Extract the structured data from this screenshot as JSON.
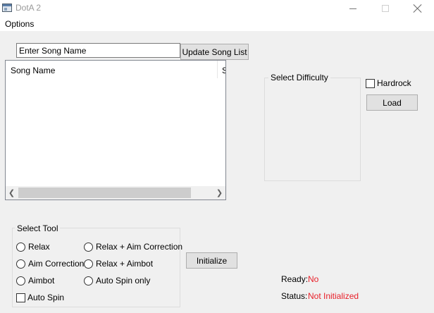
{
  "window": {
    "title": "DotA 2",
    "icon": "application-window-icon",
    "controls": {
      "minimize": "minimize-icon",
      "maximize": "maximize-icon",
      "close": "close-icon"
    }
  },
  "menu": {
    "items": [
      {
        "label": "Options"
      }
    ]
  },
  "song_search": {
    "value": "Enter Song Name"
  },
  "buttons": {
    "update_song_list": "Update Song List",
    "load": "Load",
    "initialize": "Initialize"
  },
  "song_list": {
    "columns": [
      "Song Name",
      "S"
    ],
    "rows": []
  },
  "difficulty": {
    "group_label": "Select Difficulty",
    "hardrock_label": "Hardrock",
    "hardrock_checked": false
  },
  "tool": {
    "group_label": "Select Tool",
    "options": [
      {
        "label": "Relax",
        "selected": false
      },
      {
        "label": "Aim Correction",
        "selected": false
      },
      {
        "label": "Aimbot",
        "selected": false
      },
      {
        "label": "Relax + Aim Correction",
        "selected": false
      },
      {
        "label": "Relax + Aimbot",
        "selected": false
      },
      {
        "label": "Auto Spin only",
        "selected": false
      }
    ],
    "auto_spin_label": "Auto Spin",
    "auto_spin_checked": false
  },
  "status": {
    "ready_label": "Ready:",
    "ready_value": "No",
    "status_label": "Status:",
    "status_value": "Not Initialized",
    "value_color": "#e8202a"
  }
}
